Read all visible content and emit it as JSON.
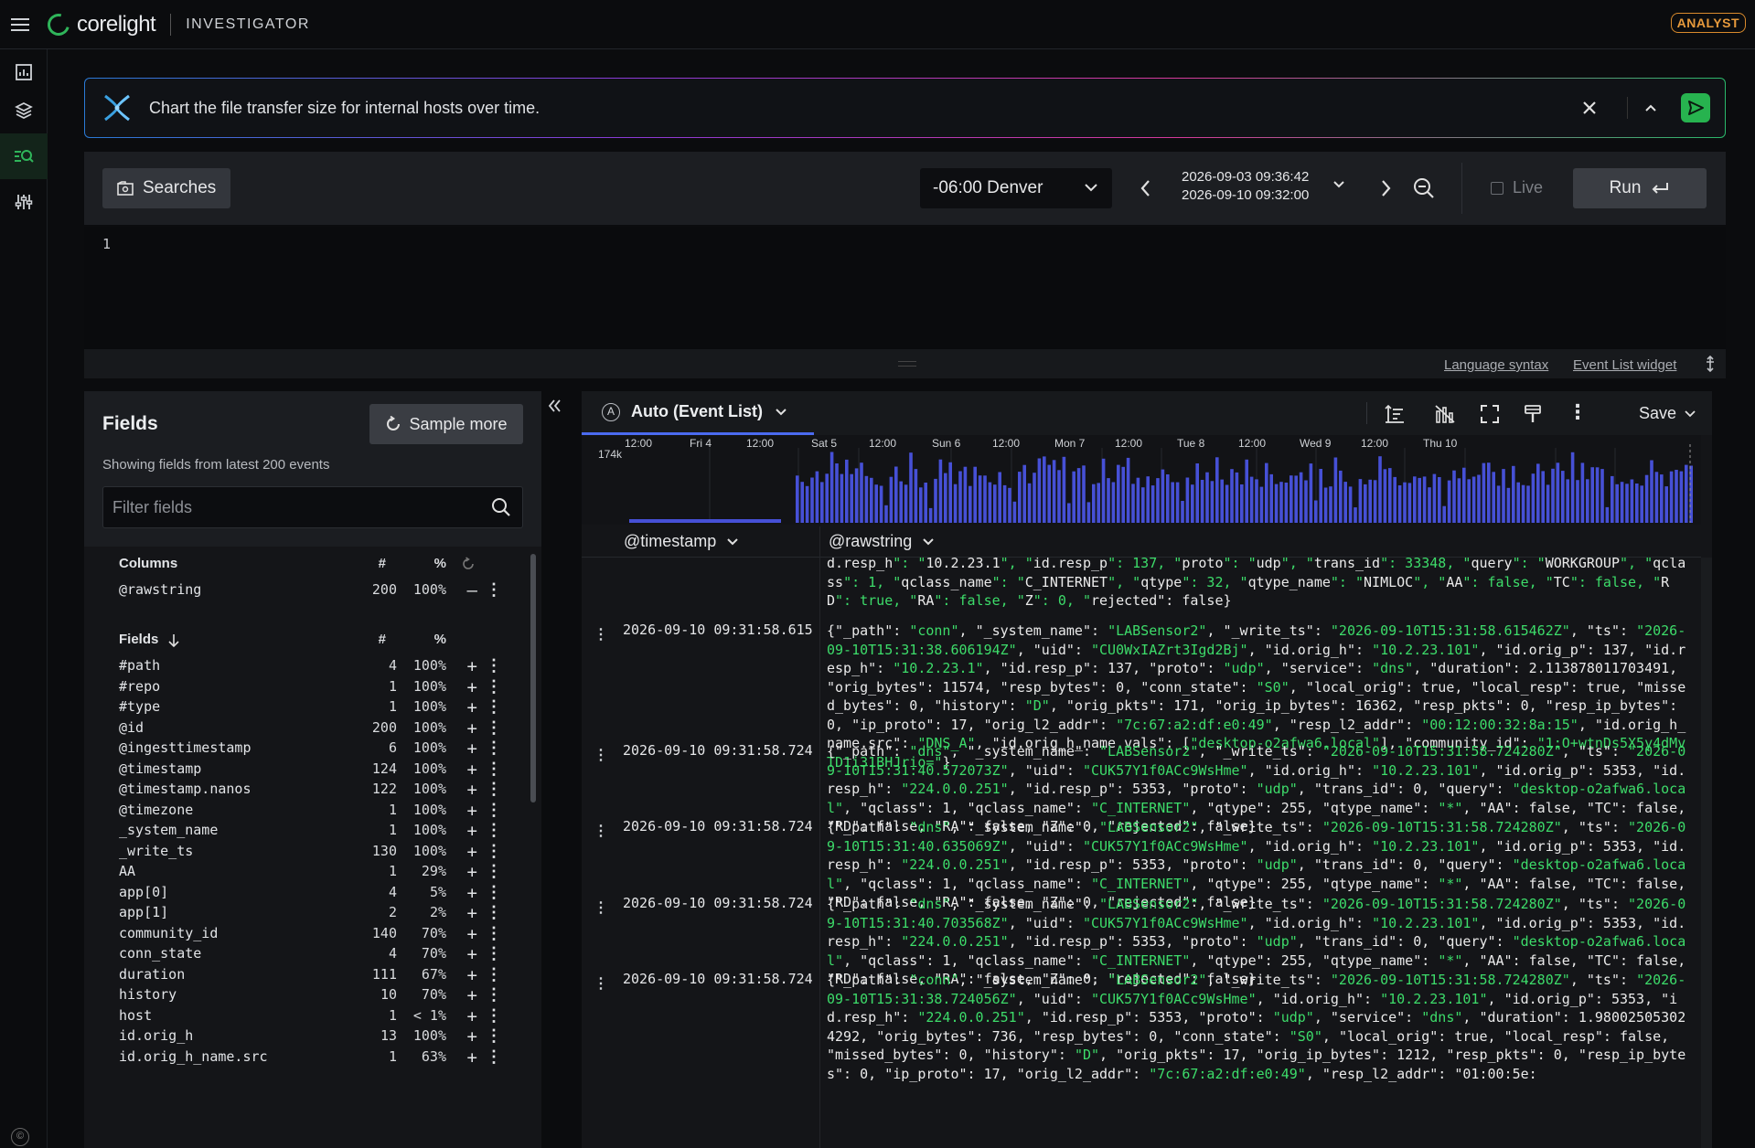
{
  "app": {
    "brand": "corelight",
    "product": "INVESTIGATOR",
    "role": "ANALYST"
  },
  "colors": {
    "accent": "#2fb55a",
    "histogram": "#4650d6",
    "json_string": "#3ddc6a",
    "role_badge": "#e79a3c"
  },
  "rail": {
    "items": [
      {
        "icon": "dashboard-icon"
      },
      {
        "icon": "layers-icon"
      },
      {
        "icon": "search-logs-icon",
        "active": true
      },
      {
        "icon": "sliders-icon"
      }
    ]
  },
  "prompt": {
    "text": "Chart the file transfer size for internal hosts over time."
  },
  "toolbar": {
    "searches_label": "Searches",
    "timezone": "-06:00 Denver",
    "range_start": "2026-09-03 09:36:42",
    "range_end": "2026-09-10 09:32:00",
    "live_label": "Live",
    "run_label": "Run"
  },
  "editor": {
    "line_number": "1",
    "link_syntax": "Language syntax",
    "link_widget": "Event List widget"
  },
  "fields_panel": {
    "title": "Fields",
    "sample_more": "Sample more",
    "subtitle": "Showing fields from latest 200 events",
    "filter_placeholder": "Filter fields",
    "columns_header": {
      "name": "Columns",
      "count": "#",
      "pct": "%"
    },
    "columns": [
      {
        "name": "@rawstring",
        "count": "200",
        "pct": "100%",
        "action": "—"
      }
    ],
    "fields_header": {
      "name": "Fields",
      "count": "#",
      "pct": "%"
    },
    "fields": [
      {
        "name": "#path",
        "count": "4",
        "pct": "100%"
      },
      {
        "name": "#repo",
        "count": "1",
        "pct": "100%"
      },
      {
        "name": "#type",
        "count": "1",
        "pct": "100%"
      },
      {
        "name": "@id",
        "count": "200",
        "pct": "100%"
      },
      {
        "name": "@ingesttimestamp",
        "count": "6",
        "pct": "100%"
      },
      {
        "name": "@timestamp",
        "count": "124",
        "pct": "100%"
      },
      {
        "name": "@timestamp.nanos",
        "count": "122",
        "pct": "100%"
      },
      {
        "name": "@timezone",
        "count": "1",
        "pct": "100%"
      },
      {
        "name": "_system_name",
        "count": "1",
        "pct": "100%"
      },
      {
        "name": "_write_ts",
        "count": "130",
        "pct": "100%"
      },
      {
        "name": "AA",
        "count": "1",
        "pct": "29%"
      },
      {
        "name": "app[0]",
        "count": "4",
        "pct": "5%"
      },
      {
        "name": "app[1]",
        "count": "2",
        "pct": "2%"
      },
      {
        "name": "community_id",
        "count": "140",
        "pct": "70%"
      },
      {
        "name": "conn_state",
        "count": "4",
        "pct": "70%"
      },
      {
        "name": "duration",
        "count": "111",
        "pct": "67%"
      },
      {
        "name": "history",
        "count": "10",
        "pct": "70%"
      },
      {
        "name": "host",
        "count": "1",
        "pct": "< 1%"
      },
      {
        "name": "id.orig_h",
        "count": "13",
        "pct": "100%"
      },
      {
        "name": "id.orig_h_name.src",
        "count": "1",
        "pct": "63%"
      }
    ]
  },
  "results": {
    "tab_label": "Auto (Event List)",
    "save_label": "Save",
    "histogram": {
      "y_max_label": "174k",
      "x_labels": [
        "12:00",
        "Fri 4",
        "12:00",
        "Sat 5",
        "12:00",
        "Sun 6",
        "12:00",
        "Mon 7",
        "12:00",
        "Tue 8",
        "12:00",
        "Wed 9",
        "12:00",
        "Thu 10"
      ]
    },
    "columns": {
      "timestamp": "@timestamp",
      "rawstring": "@rawstring"
    },
    "events": [
      {
        "timestamp": "",
        "raw": "d.resp_h\": \"10.2.23.1\", \"id.resp_p\": 137, \"proto\": \"udp\", \"trans_id\": 33348, \"query\": \"WORKGROUP\", \"qclass\": 1, \"qclass_name\": \"C_INTERNET\", \"qtype\": 32, \"qtype_name\": \"NIMLOC\", \"AA\": false, \"TC\": false, \"RD\": true, \"RA\": false, \"Z\": 0, \"rejected\": false}"
      },
      {
        "timestamp": "2026-09-10 09:31:58.615",
        "raw": "{\"_path\": \"conn\", \"_system_name\": \"LABSensor2\", \"_write_ts\": \"2026-09-10T15:31:58.615462Z\", \"ts\": \"2026-09-10T15:31:38.606194Z\", \"uid\": \"CU0WxIAZrt3Igd2Bj\", \"id.orig_h\": \"10.2.23.101\", \"id.orig_p\": 137, \"id.resp_h\": \"10.2.23.1\", \"id.resp_p\": 137, \"proto\": \"udp\", \"service\": \"dns\", \"duration\": 2.113878011703491, \"orig_bytes\": 11574, \"resp_bytes\": 0, \"conn_state\": \"S0\", \"local_orig\": true, \"local_resp\": true, \"missed_bytes\": 0, \"history\": \"D\", \"orig_pkts\": 171, \"orig_ip_bytes\": 16362, \"resp_pkts\": 0, \"resp_ip_bytes\": 0, \"ip_proto\": 17, \"orig_l2_addr\": \"7c:67:a2:df:e0:49\", \"resp_l2_addr\": \"00:12:00:32:8a:15\", \"id.orig_h_name.src\": \"DNS_A\", \"id.orig_h_name.vals\": [\"desktop-o2afwa6.local\"], \"community_id\": \"1:O+wtnDs5X5y4dMvTD1i31BHJrio=\"}"
      },
      {
        "timestamp": "2026-09-10 09:31:58.724",
        "raw": "{\"_path\": \"dns\", \"_system_name\": \"LABSensor2\", \"_write_ts\": \"2026-09-10T15:31:58.724280Z\", \"ts\": \"2026-09-10T15:31:40.572073Z\", \"uid\": \"CUK57Y1f0ACc9WsHme\", \"id.orig_h\": \"10.2.23.101\", \"id.orig_p\": 5353, \"id.resp_h\": \"224.0.0.251\", \"id.resp_p\": 5353, \"proto\": \"udp\", \"trans_id\": 0, \"query\": \"desktop-o2afwa6.local\", \"qclass\": 1, \"qclass_name\": \"C_INTERNET\", \"qtype\": 255, \"qtype_name\": \"*\", \"AA\": false, \"TC\": false, \"RD\": false, \"RA\": false, \"Z\": 0, \"rejected\": false}"
      },
      {
        "timestamp": "2026-09-10 09:31:58.724",
        "raw": "{\"_path\": \"dns\", \"_system_name\": \"LABSensor2\", \"_write_ts\": \"2026-09-10T15:31:58.724280Z\", \"ts\": \"2026-09-10T15:31:40.635069Z\", \"uid\": \"CUK57Y1f0ACc9WsHme\", \"id.orig_h\": \"10.2.23.101\", \"id.orig_p\": 5353, \"id.resp_h\": \"224.0.0.251\", \"id.resp_p\": 5353, \"proto\": \"udp\", \"trans_id\": 0, \"query\": \"desktop-o2afwa6.local\", \"qclass\": 1, \"qclass_name\": \"C_INTERNET\", \"qtype\": 255, \"qtype_name\": \"*\", \"AA\": false, \"TC\": false, \"RD\": false, \"RA\": false, \"Z\": 0, \"rejected\": false}"
      },
      {
        "timestamp": "2026-09-10 09:31:58.724",
        "raw": "{\"_path\": \"dns\", \"_system_name\": \"LABSensor2\", \"_write_ts\": \"2026-09-10T15:31:58.724280Z\", \"ts\": \"2026-09-10T15:31:40.703568Z\", \"uid\": \"CUK57Y1f0ACc9WsHme\", \"id.orig_h\": \"10.2.23.101\", \"id.orig_p\": 5353, \"id.resp_h\": \"224.0.0.251\", \"id.resp_p\": 5353, \"proto\": \"udp\", \"trans_id\": 0, \"query\": \"desktop-o2afwa6.local\", \"qclass\": 1, \"qclass_name\": \"C_INTERNET\", \"qtype\": 255, \"qtype_name\": \"*\", \"AA\": false, \"TC\": false, \"RD\": false, \"RA\": false, \"Z\": 0, \"rejected\": false}"
      },
      {
        "timestamp": "2026-09-10 09:31:58.724",
        "raw": "{\"_path\": \"conn\", \"_system_name\": \"LABSensor2\", \"_write_ts\": \"2026-09-10T15:31:58.724280Z\", \"ts\": \"2026-09-10T15:31:38.724056Z\", \"uid\": \"CUK57Y1f0ACc9WsHme\", \"id.orig_h\": \"10.2.23.101\", \"id.orig_p\": 5353, \"id.resp_h\": \"224.0.0.251\", \"id.resp_p\": 5353, \"proto\": \"udp\", \"service\": \"dns\", \"duration\": 1.980025053024292, \"orig_bytes\": 736, \"resp_bytes\": 0, \"conn_state\": \"S0\", \"local_orig\": true, \"local_resp\": false, \"missed_bytes\": 0, \"history\": \"D\", \"orig_pkts\": 17, \"orig_ip_bytes\": 1212, \"resp_pkts\": 0, \"resp_ip_bytes\": 0, \"ip_proto\": 17, \"orig_l2_addr\": \"7c:67:a2:df:e0:49\", \"resp_l2_addr\": \"01:00:5e:"
      }
    ]
  }
}
